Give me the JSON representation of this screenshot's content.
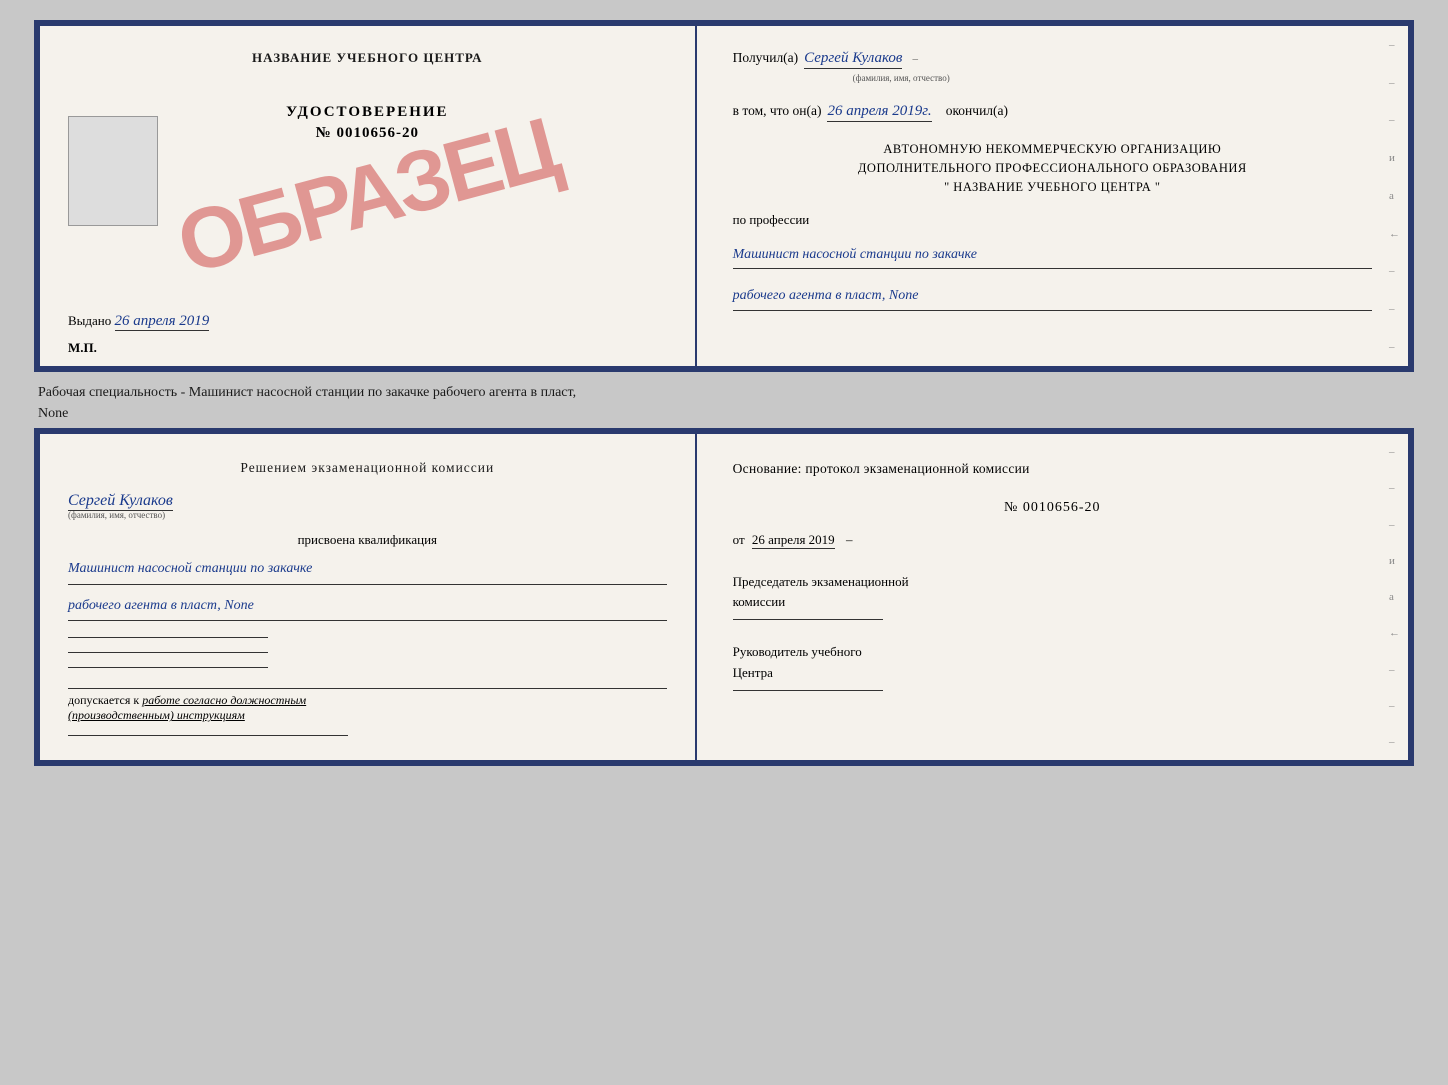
{
  "topCert": {
    "leftTitle": "НАЗВАНИЕ УЧЕБНОГО ЦЕНТРА",
    "stampText": "ОБРАЗЕЦ",
    "udostovTitle": "УДОСТОВЕРЕНИЕ",
    "udostovNumber": "№ 0010656-20",
    "vydano": "Выдано",
    "vydanoDate": "26 апреля 2019",
    "mp": "М.П."
  },
  "topRight": {
    "poluchilLabel": "Получил(а)",
    "poluchilName": "Сергей Кулаков",
    "nameHint": "(фамилия, имя, отчество)",
    "vtomLabel": "в том, что он(а)",
    "vtomDate": "26 апреля 2019г.",
    "okoncilLabel": "окончил(а)",
    "orgLine1": "АВТОНОМНУЮ НЕКОММЕРЧЕСКУЮ ОРГАНИЗАЦИЮ",
    "orgLine2": "ДОПОЛНИТЕЛЬНОГО ПРОФЕССИОНАЛЬНОГО ОБРАЗОВАНИЯ",
    "orgLine3": "\"  НАЗВАНИЕ УЧЕБНОГО ЦЕНТРА  \"",
    "proLabel": "по профессии",
    "proText1": "Машинист насосной станции по закачке",
    "proText2": "рабочего агента в пласт, None",
    "dashes": [
      "–",
      "–",
      "–",
      "и",
      "а",
      "←",
      "–",
      "–",
      "–"
    ]
  },
  "middleText": {
    "line1": "Рабочая специальность - Машинист насосной станции по закачке рабочего агента в пласт,",
    "line2": "None"
  },
  "bottomLeft": {
    "title": "Решением экзаменационной комиссии",
    "name": "Сергей Кулаков",
    "nameHint": "(фамилия, имя, отчество)",
    "prisLabel": "присвоена квалификация",
    "qualText1": "Машинист насосной станции по закачке",
    "qualText2": "рабочего агента в пласт, None",
    "dopText": "допускается к",
    "dopItalic": "работе согласно должностным",
    "dopItalic2": "(производственным) инструкциям"
  },
  "bottomRight": {
    "osnovLabel": "Основание: протокол экзаменационной комиссии",
    "protocolNumber": "№ 0010656-20",
    "otLabel": "от",
    "otDate": "26 апреля 2019",
    "predsedLabel": "Председатель экзаменационной",
    "predsedLabel2": "комиссии",
    "rukovLabel": "Руководитель учебного",
    "rukovLabel2": "Центра",
    "dashes": [
      "–",
      "–",
      "–",
      "и",
      "а",
      "←",
      "–",
      "–",
      "–"
    ]
  }
}
